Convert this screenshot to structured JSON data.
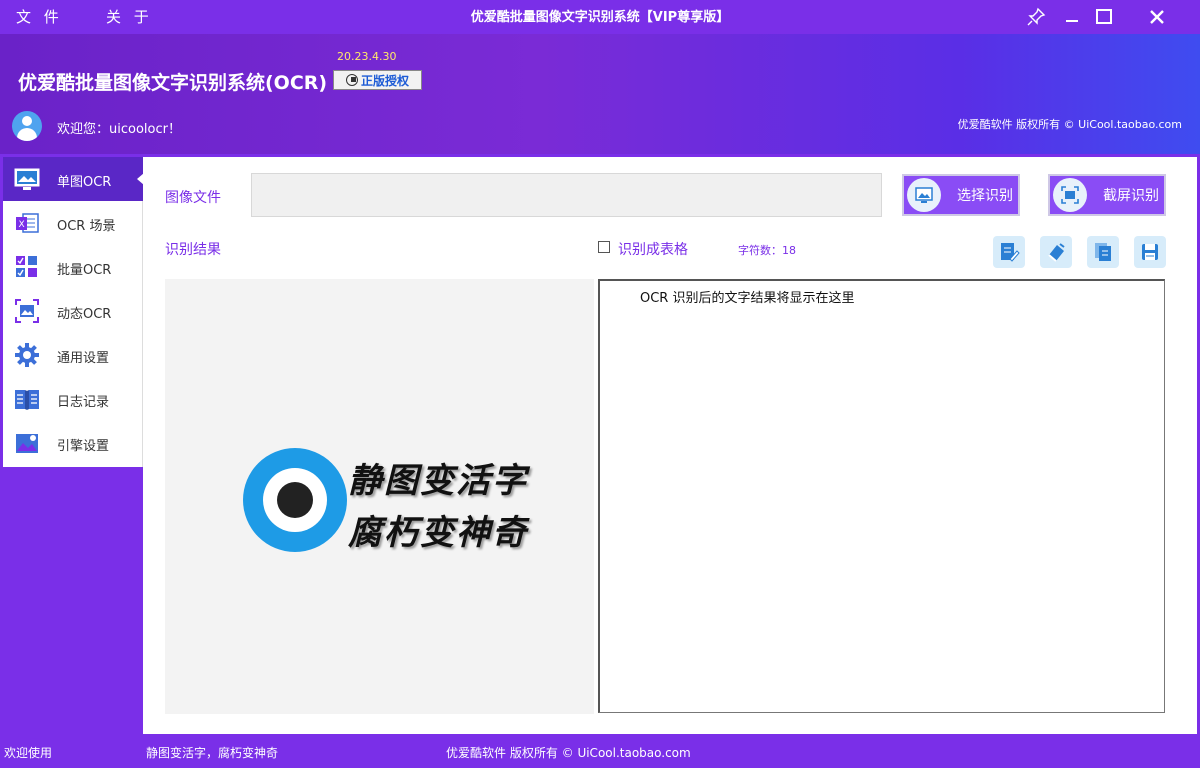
{
  "menu": {
    "file": "文 件",
    "about": "关 于"
  },
  "window": {
    "title": "优爱酷批量图像文字识别系统【VIP尊享版】"
  },
  "header": {
    "version": "20.23.4.30",
    "app_title": "优爱酷批量图像文字识别系统(OCR)",
    "license_label": "正版授权",
    "welcome": "欢迎您：uicoolocr！",
    "copyright": "优爱酷软件 版权所有 © UiCool.taobao.com"
  },
  "sidebar": {
    "items": [
      {
        "label": "单图OCR",
        "icon": "monitor-image-icon",
        "active": true
      },
      {
        "label": "OCR 场景",
        "icon": "excel-icon"
      },
      {
        "label": "批量OCR",
        "icon": "batch-images-icon"
      },
      {
        "label": "动态OCR",
        "icon": "screenshot-frame-icon"
      },
      {
        "label": "通用设置",
        "icon": "gear-icon"
      },
      {
        "label": "日志记录",
        "icon": "book-icon"
      },
      {
        "label": "引擎设置",
        "icon": "engine-image-icon"
      }
    ]
  },
  "main": {
    "file_label": "图像文件",
    "file_value": "",
    "select_button": "选择识别",
    "screenshot_button": "截屏识别",
    "result_label": "识别结果",
    "table_checkbox_label": "识别成表格",
    "char_count": "字符数：18",
    "result_text": "OCR 识别后的文字结果将显示在这里",
    "slogan_line1": "静图变活字",
    "slogan_line2": "腐朽变神奇"
  },
  "statusbar": {
    "left": "欢迎使用",
    "middle": "静图变活字，腐朽变神奇",
    "right": "优爱酷软件 版权所有 ©  UiCool.taobao.com"
  },
  "colors": {
    "accent": "#7a2fe8",
    "active_sidebar": "#5a27c6",
    "version": "#ffe96b",
    "license_text": "#1d5bd6"
  }
}
